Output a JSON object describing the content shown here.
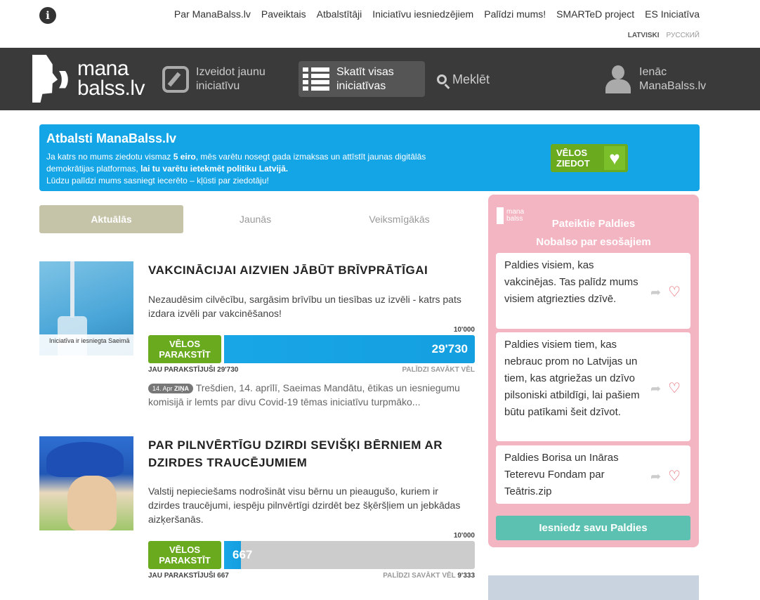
{
  "top_nav": {
    "links": [
      "Par ManaBalss.lv",
      "Paveiktais",
      "Atbalstītāji",
      "Iniciatīvu iesniedzējiem",
      "Palīdzi mums!",
      "SMARTeD project",
      "ES Iniciatīva"
    ],
    "lang_lv": "LATVISKI",
    "lang_ru": "РУССКИЙ"
  },
  "header": {
    "logo_line1": "mana",
    "logo_line2": "balss.lv",
    "create_line1": "Izveidot jaunu",
    "create_line2": "iniciatīvu",
    "view_line1": "Skatīt visas",
    "view_line2": "iniciatīvas",
    "search": "Meklēt",
    "login_line1": "Ienāc",
    "login_line2": "ManaBalss.lv"
  },
  "support": {
    "title": "Atbalsti ManaBalss.lv",
    "line1a": "Ja katrs no mums ziedotu vismaz ",
    "line1b": "5 eiro",
    "line1c": ", mēs varētu nosegt gada izmaksas un attīstīt jaunas digitālās",
    "line2a": "demokrātijas platformas, ",
    "line2b": "lai tu varētu ietekmēt politiku Latvijā.",
    "line3": "Lūdzu palīdzi mums sasniegt iecerēto – kļūsti par ziedotāju!",
    "donate_line1": "VĒLOS",
    "donate_line2": "ZIEDOT",
    "heart": "♥"
  },
  "tabs": [
    "Aktuālās",
    "Jaunās",
    "Veiksmīgākās"
  ],
  "initiatives": [
    {
      "title": "VAKCINĀCIJAI AIZVIEN JĀBŪT BRĪVPRĀTĪGAI",
      "description": "Nezaudēsim cilvēcību, sargāsim brīvību un tiesības uz izvēli - katrs pats izdara izvēli par vakcinēšanos!",
      "caption": "Iniciatīva ir iesniegta Saeimā",
      "goal": "10'000",
      "sign_line1": "VĒLOS",
      "sign_line2": "PARAKSTĪT",
      "count": "29'730",
      "progress": 1.0,
      "signed_label": "JAU PARAKSTĪJUŠI",
      "signed_value": "29'730",
      "help_label": "PALĪDZI SAVĀKT VĒL",
      "help_value": "",
      "news_date": "14. Apr",
      "news_tag": "ZIŅA",
      "news_text": "Trešdien, 14. aprīlī, Saeimas Mandātu, ētikas un iesniegumu komisijā ir lemts par divu Covid-19 tēmas iniciatīvu turpmāko..."
    },
    {
      "title": "PAR PILNVĒRTĪGU DZIRDI SEVIŠĶI BĒRNIEM AR DZIRDES TRAUCĒJUMIEM",
      "description": "Valstij nepieciešams nodrošināt visu bērnu un pieaugušo, kuriem ir dzirdes traucējumi, iespēju pilnvērtīgi dzirdēt bez šķēršļiem un jebkādas aizķeršanās.",
      "goal": "10'000",
      "sign_line1": "VĒLOS",
      "sign_line2": "PARAKSTĪT",
      "count": "667",
      "progress": 0.0667,
      "signed_label": "JAU PARAKSTĪJUŠI",
      "signed_value": "667",
      "help_label": "PALĪDZI SAVĀKT VĒL",
      "help_value": "9'333"
    }
  ],
  "sidebar": {
    "logo_line1": "mana",
    "logo_line2": "balss",
    "title_line1": "Pateiktie Paldies",
    "title_line2": "Nobalso par esošajiem",
    "thanks": [
      "Paldies visiem, kas vakcinējas. Tas palīdz mums visiem atgriezties dzīvē.",
      "Paldies visiem tiem, kas nebrauc prom no Latvijas un tiem, kas atgriežas un dzīvo pilsoniski atbildīgi, lai pašiem būtu patīkami šeit dzīvot.",
      "Paldies Borisa un Ināras Teterevu Fondam par Teātris.zip"
    ],
    "submit": "Iesniedz savu Paldies"
  },
  "colors": {
    "header_bg": "#3a3a3a",
    "banner_bg": "#14a5e6",
    "sign_green": "#6aaa1f",
    "progress_blue": "#19a6e6",
    "sidebar_pink": "#f4b5c2",
    "submit_teal": "#5cc1b0"
  }
}
